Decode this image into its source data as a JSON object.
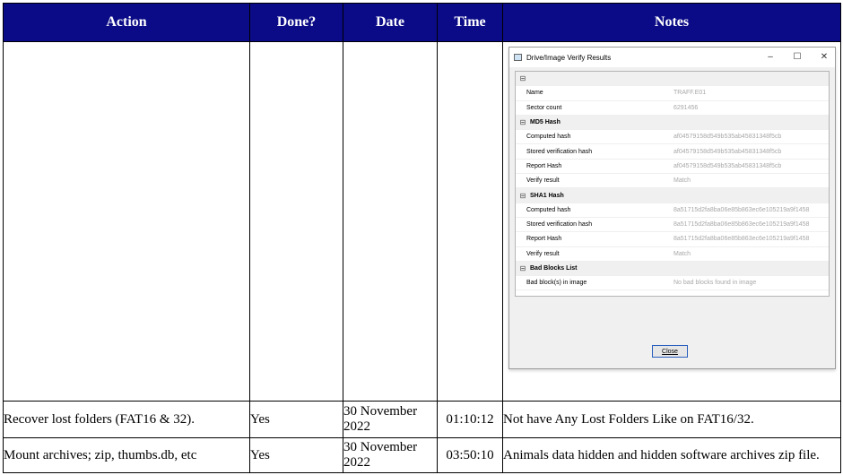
{
  "table": {
    "headers": [
      "Action",
      "Done?",
      "Date",
      "Time",
      "Notes"
    ],
    "rows": [
      {
        "action": "",
        "done": "",
        "date": "",
        "time": "",
        "notes": ""
      },
      {
        "action": "Recover lost folders (FAT16 & 32).",
        "done": "Yes",
        "date": "30 November 2022",
        "time": "01:10:12",
        "notes": "Not have Any Lost Folders Like on FAT16/32."
      },
      {
        "action": "Mount archives; zip, thumbs.db, etc",
        "done": "Yes",
        "date": "30 November 2022",
        "time": "03:50:10",
        "notes": "Animals data hidden and hidden software archives zip file."
      }
    ]
  },
  "dialog": {
    "title": "Drive/Image Verify Results",
    "icon": "window-app-icon",
    "controls": {
      "minimize": "–",
      "maximize": "☐",
      "close": "✕"
    },
    "root_expander": "⊟",
    "properties": [
      {
        "name": "Name",
        "value": "TRAFF.E01"
      },
      {
        "name": "Sector count",
        "value": "6291456"
      }
    ],
    "sections": [
      {
        "title": "MD5 Hash",
        "expander": "⊟",
        "items": [
          {
            "name": "Computed hash",
            "value": "af04579158d549b535ab45831348f5cb"
          },
          {
            "name": "Stored verification hash",
            "value": "af04579158d549b535ab45831348f5cb"
          },
          {
            "name": "Report Hash",
            "value": "af04579158d549b535ab45831348f5cb"
          },
          {
            "name": "Verify result",
            "value": "Match"
          }
        ]
      },
      {
        "title": "SHA1 Hash",
        "expander": "⊟",
        "items": [
          {
            "name": "Computed hash",
            "value": "8a51715d2fa8ba06e85b863ec6e105219a9f1458"
          },
          {
            "name": "Stored verification hash",
            "value": "8a51715d2fa8ba06e85b863ec6e105219a9f1458"
          },
          {
            "name": "Report Hash",
            "value": "8a51715d2fa8ba06e85b863ec6e105219a9f1458"
          },
          {
            "name": "Verify result",
            "value": "Match"
          }
        ]
      },
      {
        "title": "Bad Blocks List",
        "expander": "⊟",
        "items": [
          {
            "name": "Bad block(s) in image",
            "value": "No bad blocks found in image"
          }
        ]
      }
    ],
    "close_label": "Close"
  }
}
